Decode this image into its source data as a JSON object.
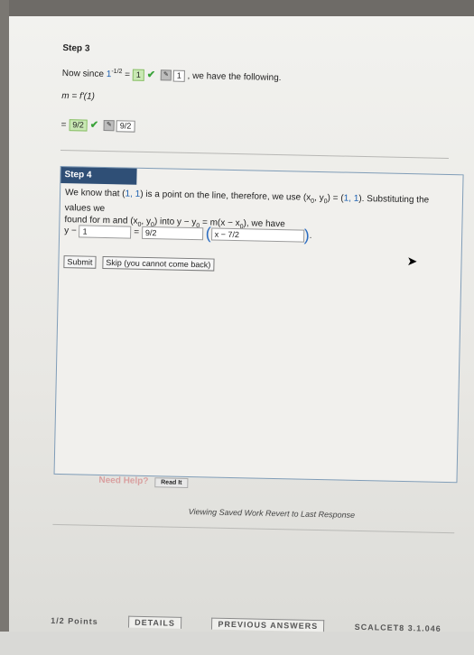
{
  "step3": {
    "title": "Step 3",
    "line1_prefix": "Now since",
    "line1_expr": "1",
    "line1_exp": "-1/2",
    "line1_eq": "=",
    "line1_answer": "1",
    "line1_answer2": "1",
    "line1_suffix": ", we have the following.",
    "line2": "m = f'(1)",
    "line3_eq": "=",
    "line3_answer": "9/2",
    "line3_answer2": "9/2"
  },
  "step4": {
    "header": "Step 4",
    "text_a": "We know that (",
    "point": "1, 1",
    "text_b": ") is a point on the line, therefore, we use (x",
    "text_c": ", y",
    "text_d": ") = (",
    "point2": "1, 1",
    "text_e": "). Substituting the values we",
    "text_f": "found for m and (x",
    "text_g": ", y",
    "text_h": ") into y − y",
    "text_i": " = m(x − x",
    "text_j": "), we have",
    "eq_left": "y −",
    "input1": "1",
    "eq_mid": "=",
    "input2": "9/2",
    "input3": "x − 7/2",
    "eq_close": ".",
    "submit": "Submit",
    "skip": "Skip (you cannot come back)"
  },
  "help": {
    "label": "Need Help?",
    "read": "Read It"
  },
  "viewing": "Viewing Saved Work Revert to Last Response",
  "bottom": {
    "b1": "1/2 Points",
    "b2": "DETAILS",
    "b3": "PREVIOUS ANSWERS",
    "b4": "SCALCET8 3.1.046"
  }
}
